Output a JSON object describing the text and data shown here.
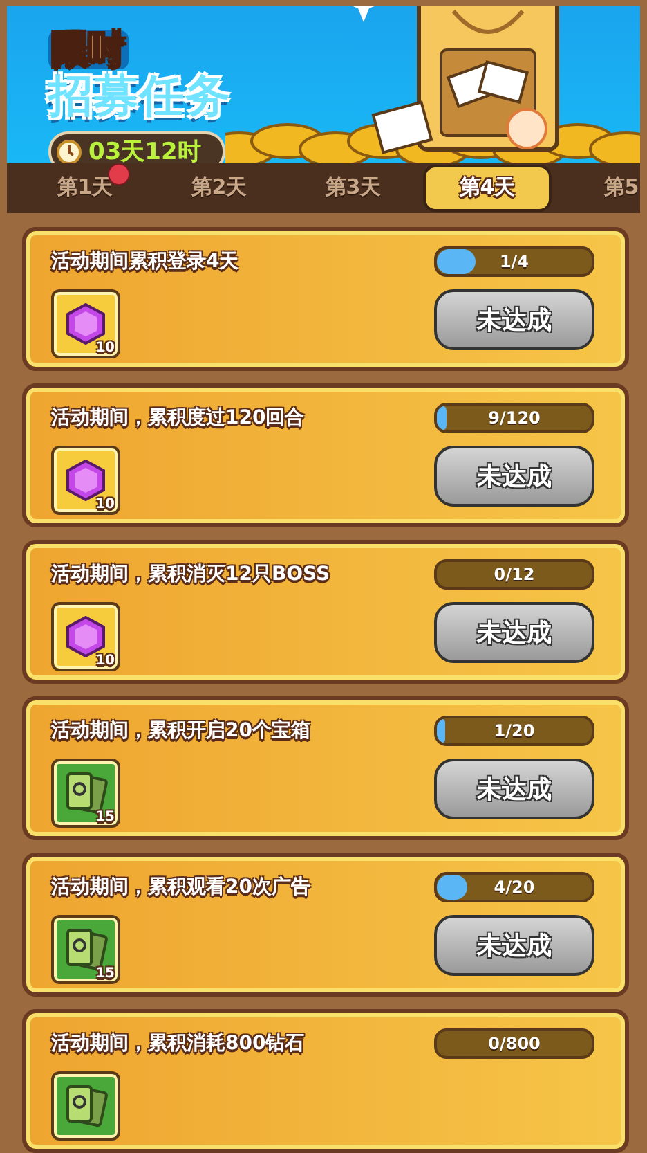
{
  "banner": {
    "tag": "限时",
    "title": "招募任务",
    "timer": "03天12时"
  },
  "tabs": [
    {
      "label": "第1天",
      "selected": false,
      "badge": true
    },
    {
      "label": "第2天",
      "selected": false,
      "badge": false
    },
    {
      "label": "第3天",
      "selected": false,
      "badge": false
    },
    {
      "label": "第4天",
      "selected": true,
      "badge": false
    },
    {
      "label": "第5",
      "selected": false,
      "badge": false
    }
  ],
  "tasks": [
    {
      "title": "活动期间累积登录4天",
      "progress": "1/4",
      "level": 0.25,
      "reward": {
        "kind": "gem",
        "count": "10"
      },
      "button": "未达成"
    },
    {
      "title": "活动期间，累积度过120回合",
      "progress": "9/120",
      "level": 0.06,
      "reward": {
        "kind": "gem",
        "count": "10"
      },
      "button": "未达成"
    },
    {
      "title": "活动期间，累积消灭12只BOSS",
      "progress": "0/12",
      "level": 0,
      "reward": {
        "kind": "gem",
        "count": "10"
      },
      "button": "未达成"
    },
    {
      "title": "活动期间，累积开启20个宝箱",
      "progress": "1/20",
      "level": 0.05,
      "reward": {
        "kind": "card",
        "count": "15"
      },
      "button": "未达成"
    },
    {
      "title": "活动期间，累积观看20次广告",
      "progress": "4/20",
      "level": 0.2,
      "reward": {
        "kind": "card",
        "count": "15"
      },
      "button": "未达成"
    },
    {
      "title": "活动期间，累积消耗800钻石",
      "progress": "0/800",
      "level": 0,
      "reward": {
        "kind": "card"
      }
    }
  ]
}
